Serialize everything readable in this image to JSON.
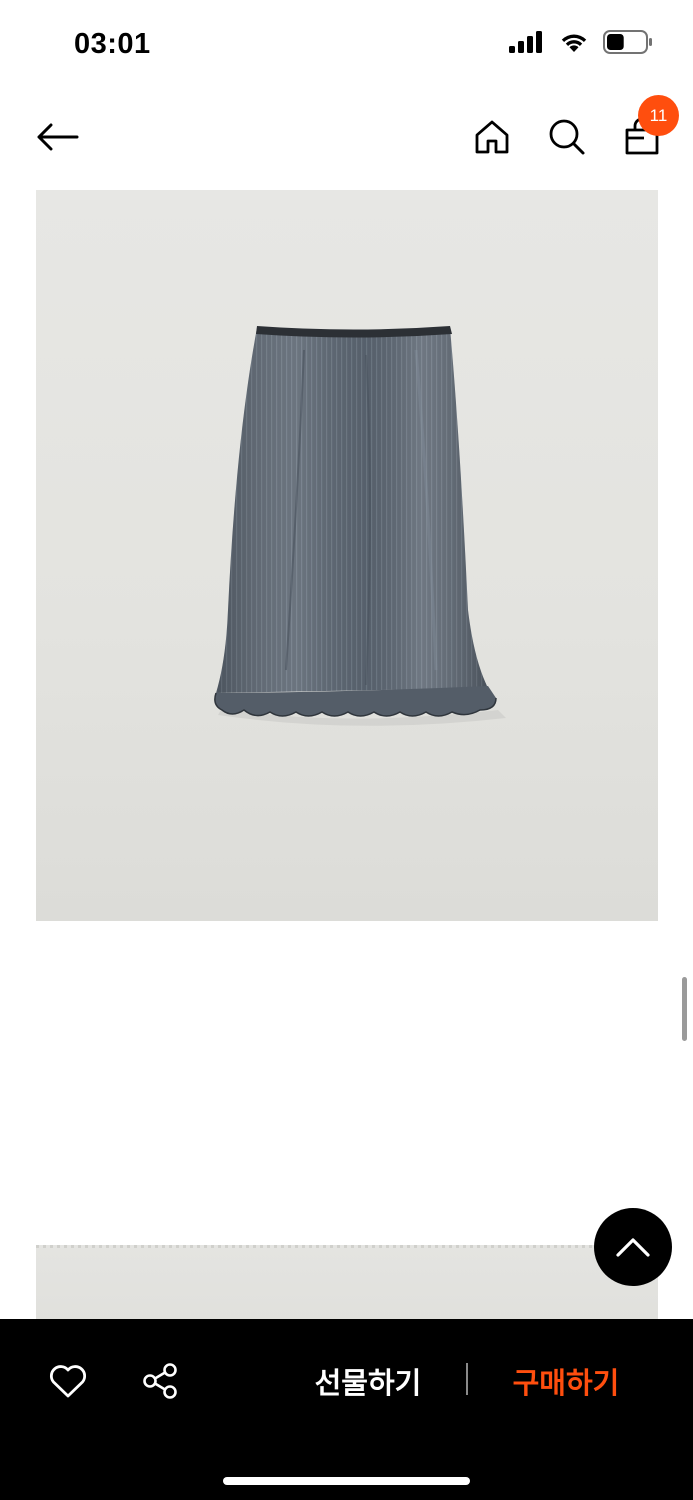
{
  "status_bar": {
    "time": "03:01",
    "icons": [
      "signal-icon",
      "wifi-icon",
      "battery-icon"
    ],
    "battery_level": 0.45
  },
  "nav": {
    "icons": [
      "back-arrow-icon",
      "home-icon",
      "search-icon",
      "shopping-bag-icon"
    ],
    "cart_count": "11"
  },
  "product": {
    "images": [
      "product-image-skirt",
      "product-image-2"
    ]
  },
  "bottom_bar": {
    "gift_label": "선물하기",
    "buy_label": "구매하기",
    "icons": [
      "heart-icon",
      "share-icon"
    ]
  },
  "colors": {
    "accent": "#ff4e0e",
    "bottom_bar_bg": "#000000",
    "product_bg": "#e4e4e1",
    "skirt": "#5a6470"
  }
}
